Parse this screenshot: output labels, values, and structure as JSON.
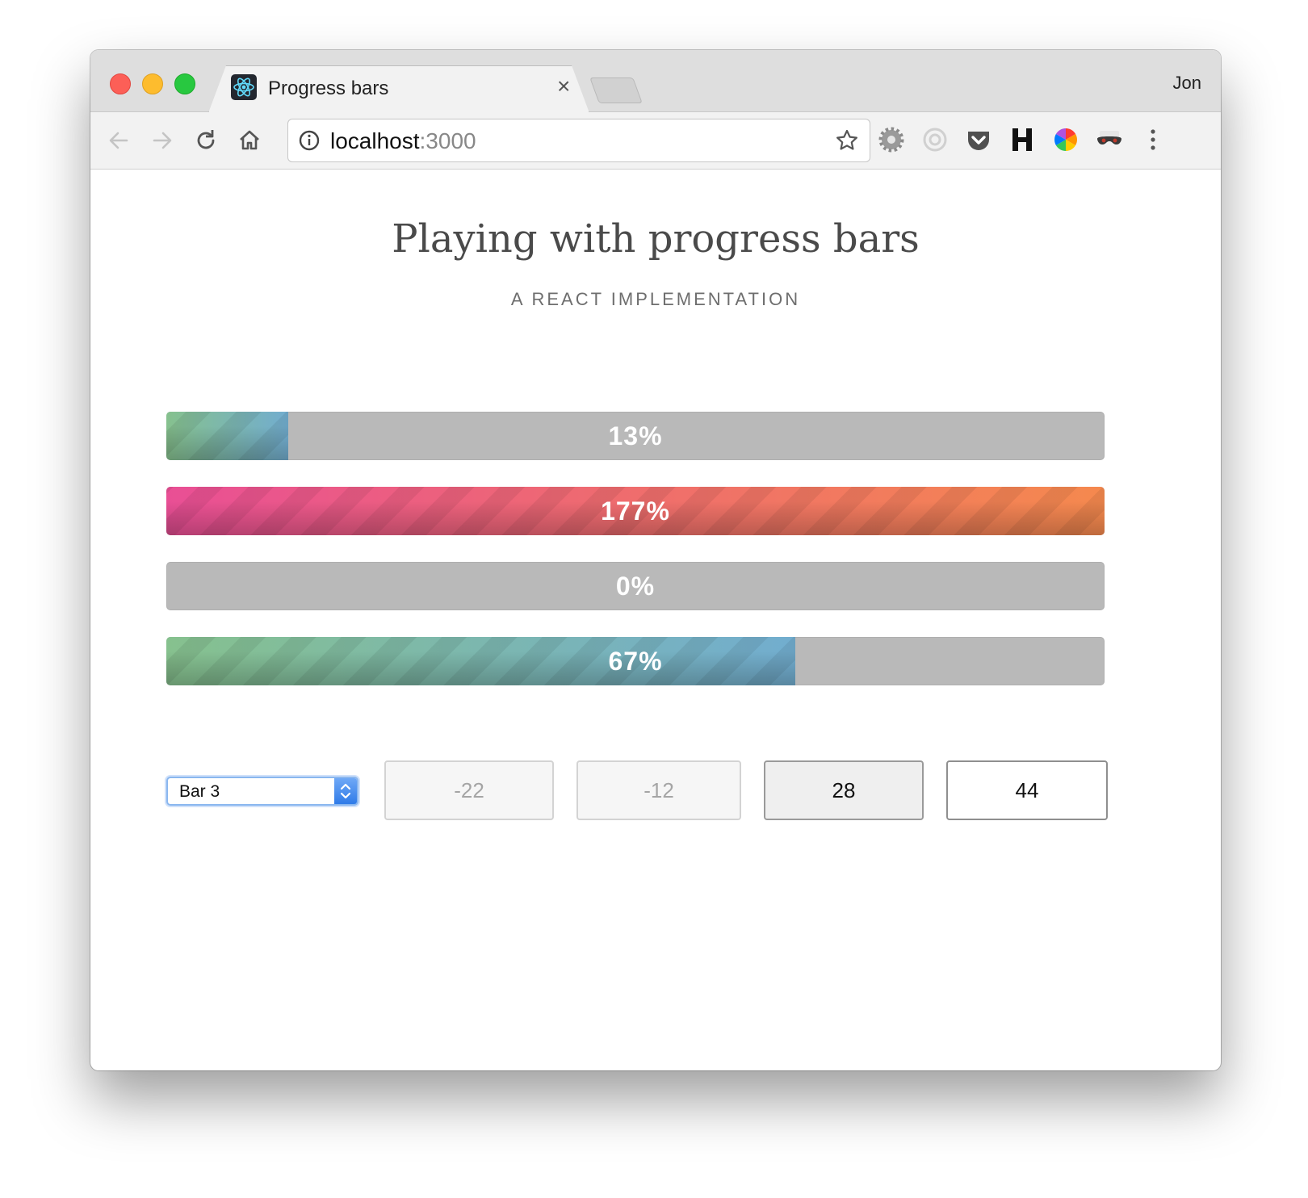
{
  "window": {
    "profile_name": "Jon"
  },
  "tab": {
    "title": "Progress bars",
    "close_glyph": "×",
    "favicon": "react-atom-icon"
  },
  "toolbar": {
    "url_host": "localhost",
    "url_port": ":3000",
    "icons": [
      "back-arrow-icon",
      "forward-arrow-icon",
      "reload-icon",
      "home-icon",
      "info-icon",
      "star-icon"
    ],
    "extensions": [
      "settings-gear-extension",
      "circle-extension",
      "pocket-extension",
      "h-extension",
      "color-wheel-extension",
      "incognito-mask-extension",
      "kebab-menu-icon"
    ]
  },
  "page": {
    "title": "Playing with progress bars",
    "subtitle": "A REACT IMPLEMENTATION"
  },
  "bars": [
    {
      "label": "13%",
      "value": 13,
      "state": "normal"
    },
    {
      "label": "177%",
      "value": 177,
      "state": "over"
    },
    {
      "label": "0%",
      "value": 0,
      "state": "normal"
    },
    {
      "label": "67%",
      "value": 67,
      "state": "normal"
    }
  ],
  "controls": {
    "select_value": "Bar 3",
    "buttons": [
      {
        "label": "-22",
        "state": "disabled"
      },
      {
        "label": "-12",
        "state": "disabled"
      },
      {
        "label": "28",
        "state": "pressed"
      },
      {
        "label": "44",
        "state": "default"
      }
    ]
  },
  "colors": {
    "bar_track": "#b9b9b9",
    "normal_fill_start": "#86c18e",
    "normal_fill_end": "#72adcf",
    "over_fill_start": "#e94f95",
    "over_fill_end": "#f5894e"
  }
}
